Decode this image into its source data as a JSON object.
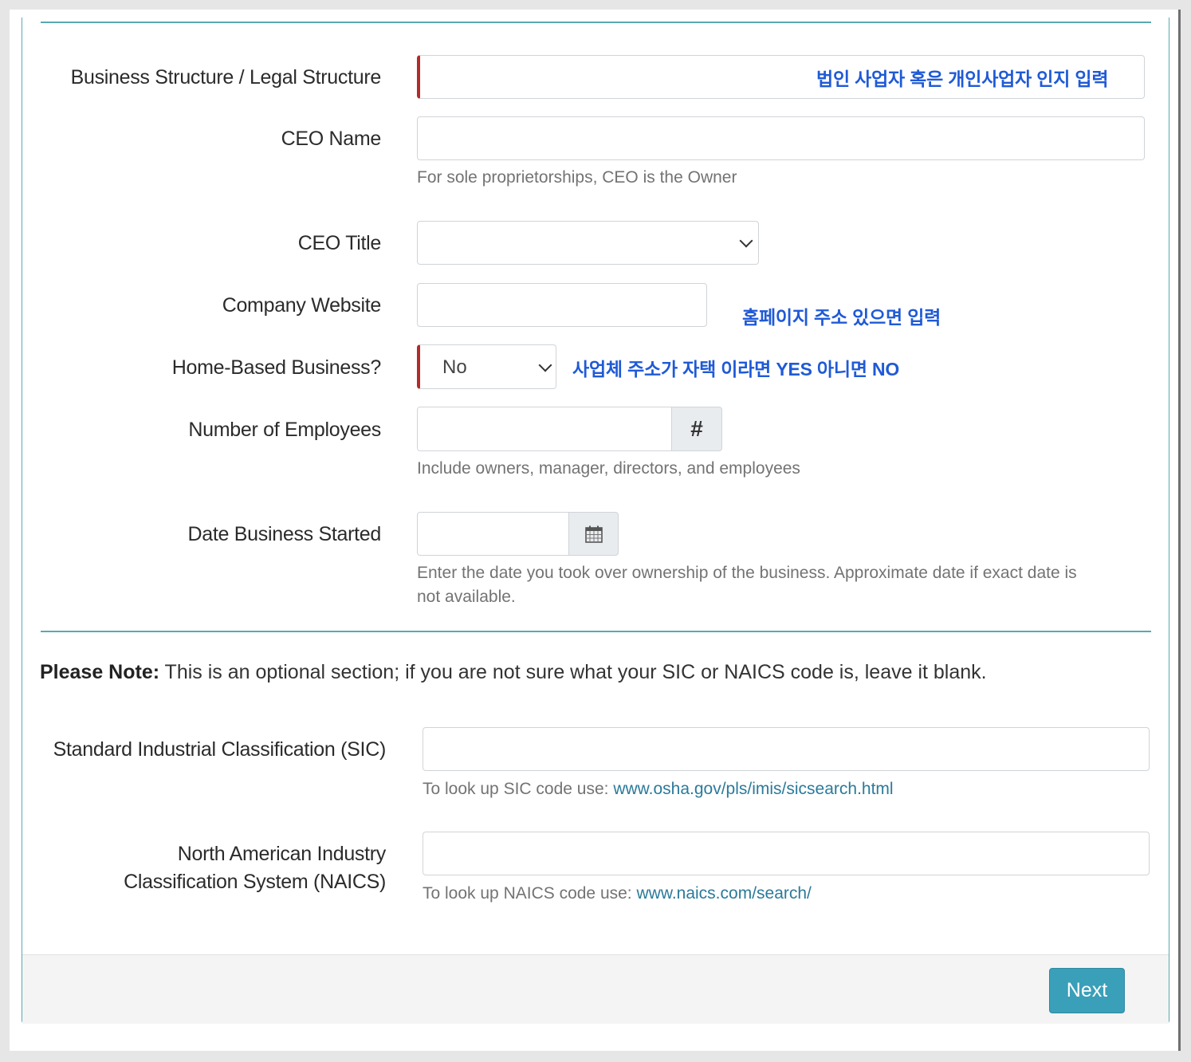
{
  "form": {
    "business_structure": {
      "label": "Business Structure / Legal Structure",
      "annotation": "법인 사업자 혹은 개인사업자 인지 입력"
    },
    "ceo_name": {
      "label": "CEO Name",
      "help": "For sole proprietorships, CEO is the Owner"
    },
    "ceo_title": {
      "label": "CEO Title",
      "value": ""
    },
    "company_website": {
      "label": "Company Website",
      "annotation": "홈페이지 주소 있으면 입력"
    },
    "home_based": {
      "label": "Home-Based Business?",
      "value": "No",
      "annotation": "사업체 주소가 자택 이라면 YES 아니면 NO"
    },
    "employees": {
      "label": "Number of Employees",
      "addon": "#",
      "help": "Include owners, manager, directors, and employees"
    },
    "date_started": {
      "label": "Date Business Started",
      "addon_icon": "calendar-icon",
      "help_line1": "Enter the date you took over ownership of the business. Approximate date if exact date is",
      "help_line2": "not available."
    }
  },
  "note": {
    "bold": "Please Note:",
    "text": " This is an optional section; if you are not sure what your SIC or NAICS code is, leave it blank."
  },
  "sic": {
    "label": "Standard Industrial Classification (SIC)",
    "help_prefix": "To look up SIC code use: ",
    "help_link": "www.osha.gov/pls/imis/sicsearch.html"
  },
  "naics": {
    "label_line1": "North American Industry",
    "label_line2": "Classification System (NAICS)",
    "help_prefix": "To look up NAICS code use: ",
    "help_link": "www.naics.com/search/"
  },
  "footer": {
    "next_label": "Next"
  },
  "colors": {
    "accent": "#3a9fb8",
    "required_border": "#b52a2a",
    "annotation": "#1f5ad6",
    "divider": "#5aa9b0"
  }
}
